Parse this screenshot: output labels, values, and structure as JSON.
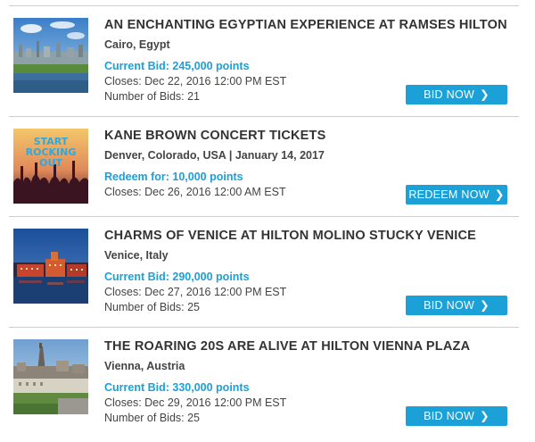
{
  "listings": [
    {
      "title": "AN ENCHANTING EGYPTIAN EXPERIENCE AT RAMSES HILTON",
      "location": "Cairo, Egypt",
      "price_label": "Current Bid: 245,000 points",
      "closes": "Closes: Dec 22, 2016 12:00 PM EST",
      "bids": "Number of Bids: 21",
      "button_label": "BID NOW",
      "button_icon": "chevron-right-icon",
      "thumbnail": "cairo-city-photo"
    },
    {
      "title": "KANE BROWN CONCERT TICKETS",
      "location": "Denver, Colorado, USA | January 14, 2017",
      "price_label": "Redeem for: 10,000 points",
      "closes": "Closes: Dec 26, 2016 12:00 AM EST",
      "button_label": "REDEEM NOW",
      "button_icon": "chevron-right-icon",
      "thumbnail": "concert-crowd-photo",
      "thumbnail_text": [
        "START",
        "ROCKING",
        "OUT"
      ]
    },
    {
      "title": "CHARMS OF VENICE AT HILTON MOLINO STUCKY VENICE",
      "location": "Venice, Italy",
      "price_label": "Current Bid: 290,000 points",
      "closes": "Closes: Dec 27, 2016 12:00 PM EST",
      "bids": "Number of Bids: 25",
      "button_label": "BID NOW",
      "button_icon": "chevron-right-icon",
      "thumbnail": "venice-night-photo"
    },
    {
      "title": "THE ROARING 20S ARE ALIVE AT HILTON VIENNA PLAZA",
      "location": "Vienna, Austria",
      "price_label": "Current Bid: 330,000 points",
      "closes": "Closes: Dec 29, 2016 12:00 PM EST",
      "bids": "Number of Bids: 25",
      "button_label": "BID NOW",
      "button_icon": "chevron-right-icon",
      "thumbnail": "vienna-city-photo"
    }
  ],
  "colors": {
    "accent": "#1ba0d8",
    "title": "#333333",
    "text": "#444444",
    "divider": "#cfcfcf"
  }
}
